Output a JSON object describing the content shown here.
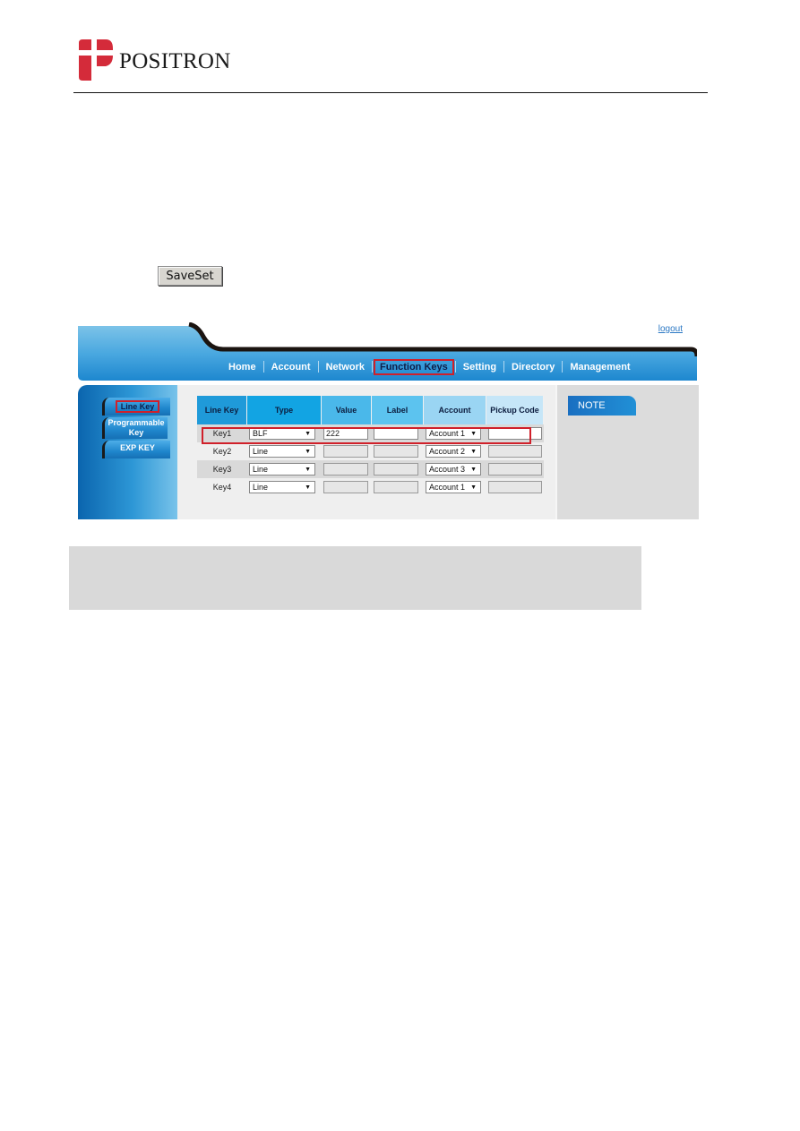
{
  "header": {
    "brand": "POSITRON",
    "logo_color": "#d42b3a"
  },
  "saveset_button": {
    "label": "SaveSet"
  },
  "web_ui": {
    "logout_label": "logout",
    "nav": [
      {
        "label": "Home",
        "active": false
      },
      {
        "label": "Account",
        "active": false
      },
      {
        "label": "Network",
        "active": false
      },
      {
        "label": "Function Keys",
        "active": true
      },
      {
        "label": "Setting",
        "active": false
      },
      {
        "label": "Directory",
        "active": false
      },
      {
        "label": "Management",
        "active": false
      }
    ],
    "sidebar": [
      {
        "label": "Line Key",
        "active": true
      },
      {
        "label": "Programmable Key",
        "active": false
      },
      {
        "label": "EXP KEY",
        "active": false
      }
    ],
    "table": {
      "headers": [
        "Line Key",
        "Type",
        "Value",
        "Label",
        "Account",
        "Pickup Code"
      ],
      "rows": [
        {
          "key": "Key1",
          "type": "BLF",
          "value": "222",
          "label": "",
          "account": "Account 1",
          "pickup_code": "",
          "highlighted": true
        },
        {
          "key": "Key2",
          "type": "Line",
          "value": "",
          "label": "",
          "account": "Account 2",
          "pickup_code": ""
        },
        {
          "key": "Key3",
          "type": "Line",
          "value": "",
          "label": "",
          "account": "Account 3",
          "pickup_code": ""
        },
        {
          "key": "Key4",
          "type": "Line",
          "value": "",
          "label": "",
          "account": "Account 1",
          "pickup_code": ""
        }
      ]
    },
    "note_label": "NOTE",
    "colors": {
      "nav_blue": "#1f8fd6",
      "highlight_red": "#d0202a"
    }
  }
}
